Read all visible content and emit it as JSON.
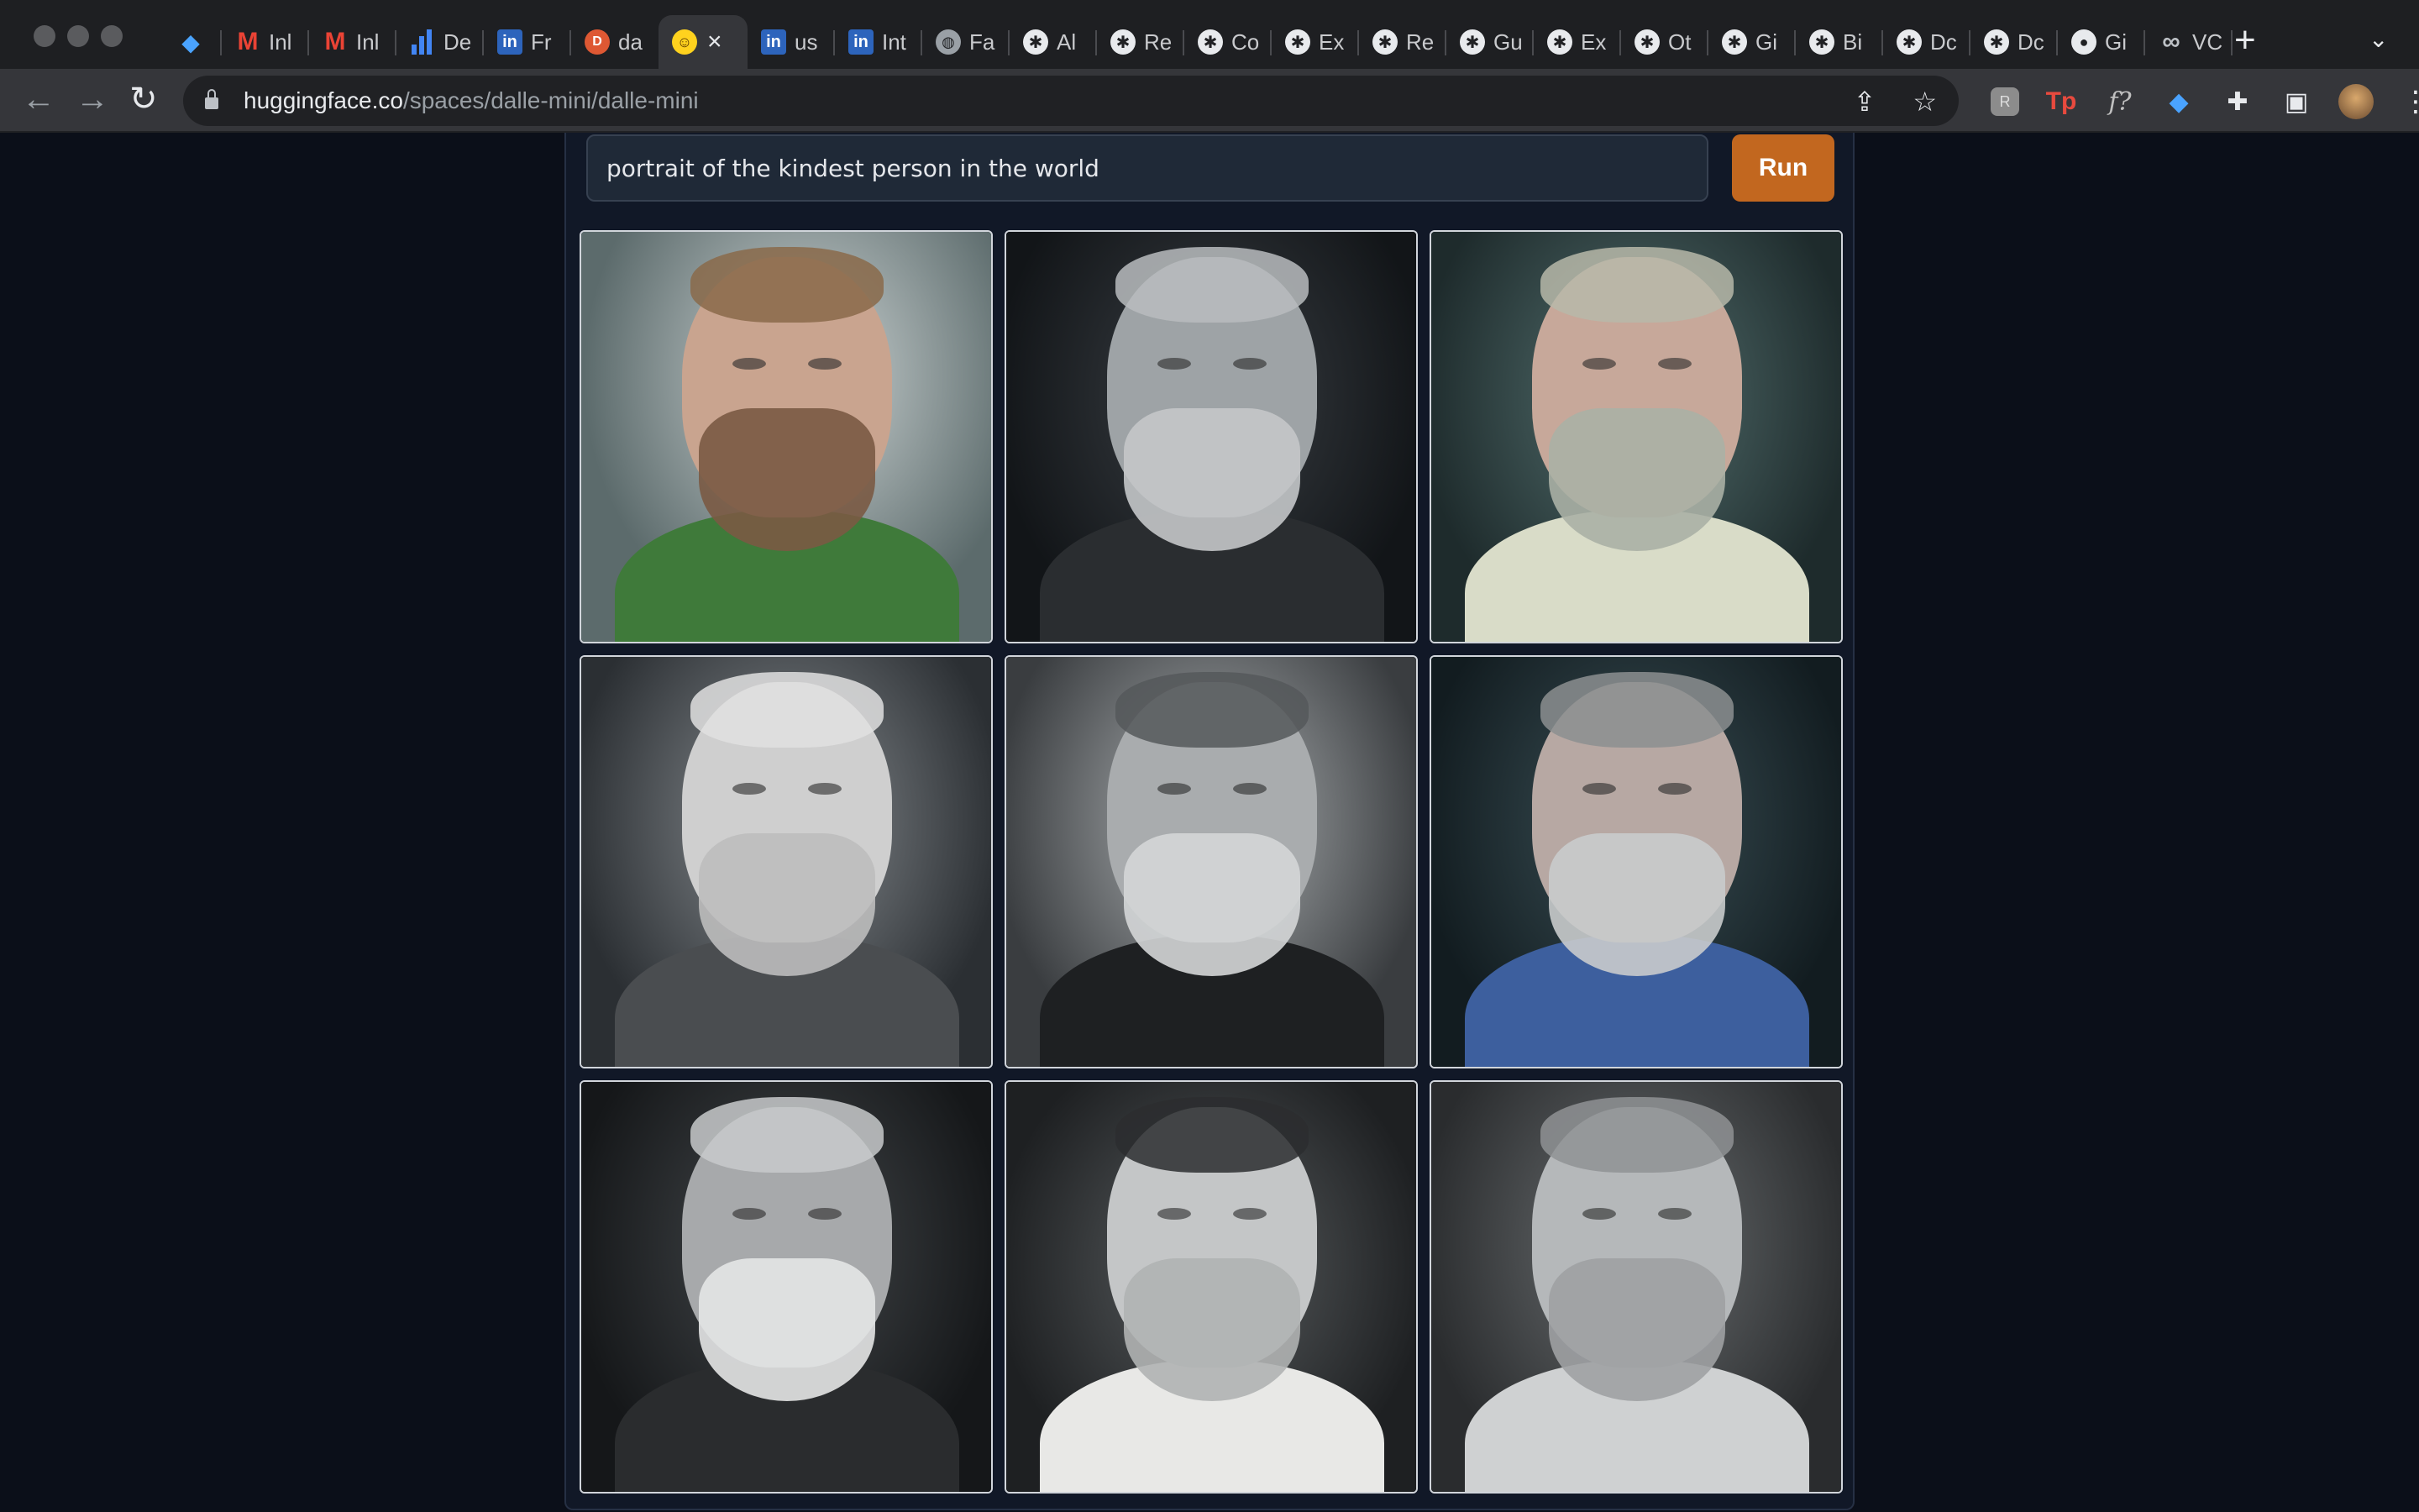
{
  "browser": {
    "tabs": [
      {
        "icon": "gem-icon",
        "label": ""
      },
      {
        "icon": "gmail-icon",
        "label": "Inl"
      },
      {
        "icon": "gmail-icon",
        "label": "Inl"
      },
      {
        "icon": "bar-chart-icon",
        "label": "De"
      },
      {
        "icon": "linkedin-icon",
        "label": "Fr"
      },
      {
        "icon": "duckduckgo-icon",
        "label": "da"
      },
      {
        "icon": "huggingface-icon",
        "label": "",
        "active": true
      },
      {
        "icon": "linkedin-icon",
        "label": "us"
      },
      {
        "icon": "linkedin-icon",
        "label": "Int"
      },
      {
        "icon": "globe-icon",
        "label": "Fa"
      },
      {
        "icon": "gear-icon",
        "label": "Al"
      },
      {
        "icon": "gear-icon",
        "label": "Re"
      },
      {
        "icon": "gear-icon",
        "label": "Co"
      },
      {
        "icon": "gear-icon",
        "label": "Ex"
      },
      {
        "icon": "gear-icon",
        "label": "Re"
      },
      {
        "icon": "gear-icon",
        "label": "Gu"
      },
      {
        "icon": "gear-icon",
        "label": "Ex"
      },
      {
        "icon": "gear-icon",
        "label": "Ot"
      },
      {
        "icon": "gear-icon",
        "label": "Gi"
      },
      {
        "icon": "gear-icon",
        "label": "Bi"
      },
      {
        "icon": "gear-icon",
        "label": "Dc"
      },
      {
        "icon": "gear-icon",
        "label": "Dc"
      },
      {
        "icon": "github-icon",
        "label": "Gi"
      },
      {
        "icon": "infinity-icon",
        "label": "VC"
      }
    ],
    "url_host": "huggingface.co",
    "url_path": "/spaces/dalle-mini/dalle-mini"
  },
  "app": {
    "prompt_value": "portrait of the kindest person in the world",
    "run_label": "Run"
  },
  "gallery": [
    {
      "bg": "bg-a",
      "skin": "#c9a48f",
      "hair": "#8a6a4a",
      "beard": "#7a5a44",
      "cloth": "#3f7a3a"
    },
    {
      "bg": "bg-b",
      "skin": "#9ea3a6",
      "hair": "#b8bcbe",
      "beard": "#c4c7c9",
      "cloth": "#2a2d30"
    },
    {
      "bg": "bg-c",
      "skin": "#c7a89a",
      "hair": "#b7b9a9",
      "beard": "#aab0a5",
      "cloth": "#d9dcc8"
    },
    {
      "bg": "bg-d",
      "skin": "#cfcfcf",
      "hair": "#e0e0e0",
      "beard": "#bdbdbd",
      "cloth": "#4a4d50"
    },
    {
      "bg": "bg-e",
      "skin": "#a9acae",
      "hair": "#55585a",
      "beard": "#d4d6d7",
      "cloth": "#1e2022"
    },
    {
      "bg": "bg-f",
      "skin": "#b7a8a3",
      "hair": "#8c8f90",
      "beard": "#c9cbcc",
      "cloth": "#3d5f9e"
    },
    {
      "bg": "bg-g",
      "skin": "#a7a9ab",
      "hair": "#c8cacb",
      "beard": "#e4e5e6",
      "cloth": "#2a2c2e"
    },
    {
      "bg": "bg-h",
      "skin": "#c4c6c7",
      "hair": "#2b2d2f",
      "beard": "#b0b2b3",
      "cloth": "#e8e8e6"
    },
    {
      "bg": "bg-i",
      "skin": "#b5b8ba",
      "hair": "#8f9294",
      "beard": "#9ea1a3",
      "cloth": "#cfd1d2"
    }
  ]
}
